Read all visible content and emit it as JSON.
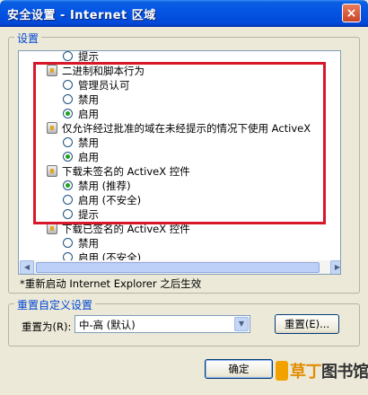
{
  "window": {
    "title": "安全设置 - Internet 区域",
    "close_glyph": "×"
  },
  "settings_group": {
    "label": "设置"
  },
  "settings_list": [
    {
      "kind": "option",
      "label": "提示",
      "checked": false
    },
    {
      "kind": "category",
      "label": "二进制和脚本行为",
      "icon": "gear-icon"
    },
    {
      "kind": "option",
      "label": "管理员认可",
      "checked": false
    },
    {
      "kind": "option",
      "label": "禁用",
      "checked": false
    },
    {
      "kind": "option",
      "label": "启用",
      "checked": true
    },
    {
      "kind": "category",
      "label": "仅允许经过批准的域在未经提示的情况下使用 ActiveX",
      "icon": "gear-icon"
    },
    {
      "kind": "option",
      "label": "禁用",
      "checked": false
    },
    {
      "kind": "option",
      "label": "启用",
      "checked": true
    },
    {
      "kind": "category",
      "label": "下载未签名的 ActiveX 控件",
      "icon": "gear-icon"
    },
    {
      "kind": "option",
      "label": "禁用 (推荐)",
      "checked": true
    },
    {
      "kind": "option",
      "label": "启用 (不安全)",
      "checked": false
    },
    {
      "kind": "option",
      "label": "提示",
      "checked": false
    },
    {
      "kind": "category",
      "label": "下载已签名的 ActiveX 控件",
      "icon": "gear-icon"
    },
    {
      "kind": "option",
      "label": "禁用",
      "checked": false
    },
    {
      "kind": "option",
      "label": "启用 (不安全)",
      "checked": false
    }
  ],
  "restart_note": "*重新启动 Internet Explorer 之后生效",
  "reset_group": {
    "label": "重置自定义设置",
    "reset_to_label": "重置为(R):",
    "reset_select_value": "中-高 (默认)",
    "reset_button_label": "重置(E)..."
  },
  "footer": {
    "ok_button_label": "确定"
  },
  "watermark": {
    "brand": "草丁图书馆",
    "accent": "草丁",
    "rest": "图书馆"
  },
  "colors": {
    "highlight_box": "#d8182a",
    "titlebar": "#0555e3",
    "checked_dot": "#21a121"
  }
}
